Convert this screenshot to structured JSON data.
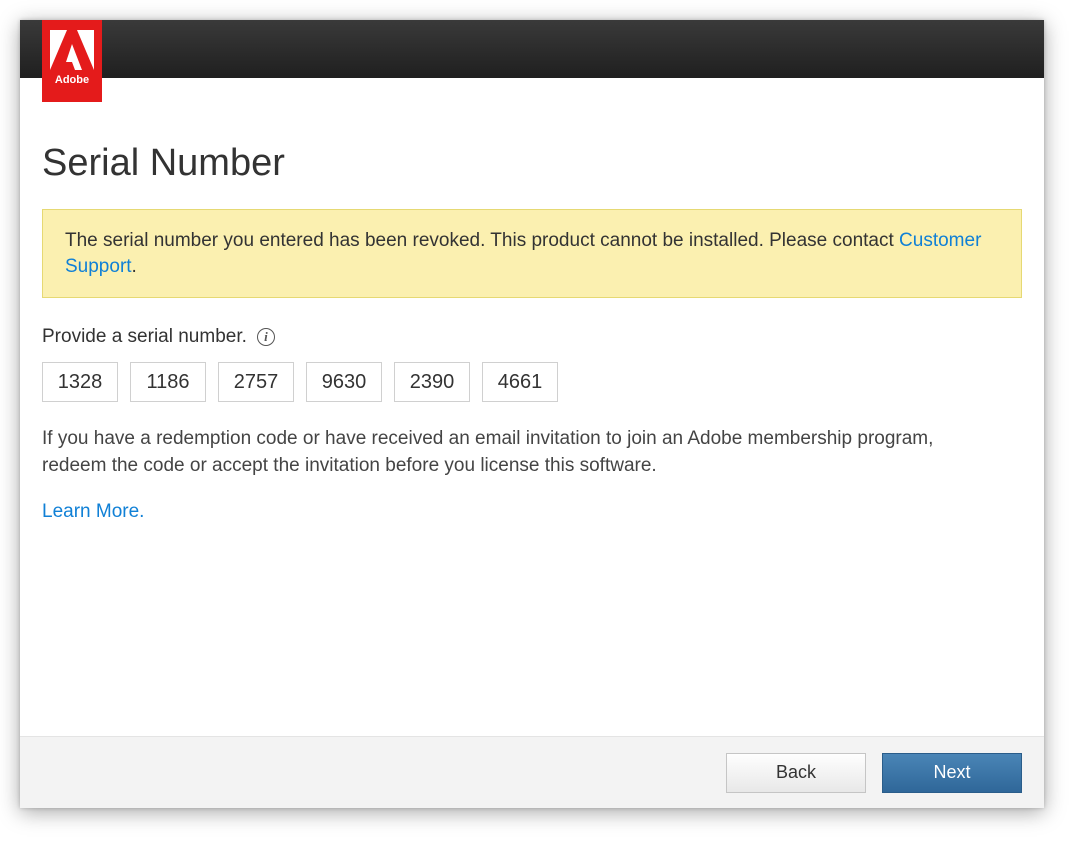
{
  "brand": {
    "name": "Adobe"
  },
  "page_title": "Serial Number",
  "alert": {
    "message_before_link": "The serial number you entered has been revoked. This product cannot be installed. Please contact ",
    "link_text": "Customer Support",
    "message_after_link": "."
  },
  "serial": {
    "prompt": "Provide a serial number.",
    "fields": [
      "1328",
      "1186",
      "2757",
      "9630",
      "2390",
      "4661"
    ]
  },
  "help_text": "If you have a redemption code or have received an email invitation to join an Adobe membership program, redeem the code or accept the invitation before you license this software.",
  "learn_more_text": "Learn More.",
  "footer": {
    "back_label": "Back",
    "next_label": "Next"
  }
}
